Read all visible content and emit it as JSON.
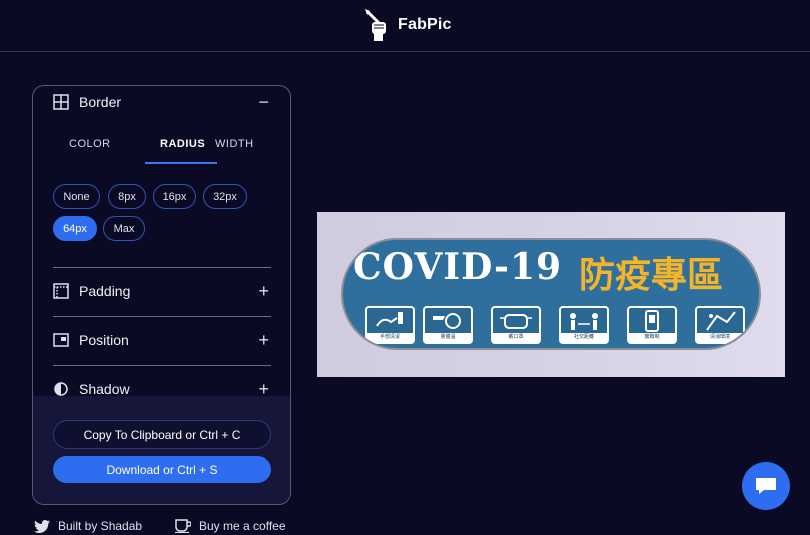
{
  "app": {
    "name": "FabPic"
  },
  "panel": {
    "border_section": {
      "title": "Border",
      "toggle": "−",
      "tabs": [
        {
          "label": "COLOR"
        },
        {
          "label": "RADIUS"
        },
        {
          "label": "WIDTH"
        }
      ],
      "active_tab": "RADIUS",
      "radius_options": [
        "None",
        "8px",
        "16px",
        "32px",
        "64px",
        "Max"
      ],
      "selected_radius": "64px"
    },
    "sections": [
      {
        "title": "Padding",
        "toggle": "+"
      },
      {
        "title": "Position",
        "toggle": "+"
      },
      {
        "title": "Shadow",
        "toggle": "+"
      }
    ],
    "actions": {
      "copy_label": "Copy To Clipboard or Ctrl + C",
      "download_label": "Download or Ctrl + S"
    }
  },
  "footer": {
    "built_by": "Built by Shadab",
    "coffee": "Buy me a coffee"
  },
  "preview": {
    "title": "COVID-19",
    "title_cn": "防疫專區",
    "icon_captions": [
      "手部清潔",
      "量體溫",
      "戴口罩",
      "社交距離",
      "實聯制",
      "清消環境"
    ]
  },
  "colors": {
    "background": "#0b0a24",
    "accent": "#2f6df0",
    "banner_blue": "#2f6f9e",
    "banner_yellow": "#f3b429"
  }
}
